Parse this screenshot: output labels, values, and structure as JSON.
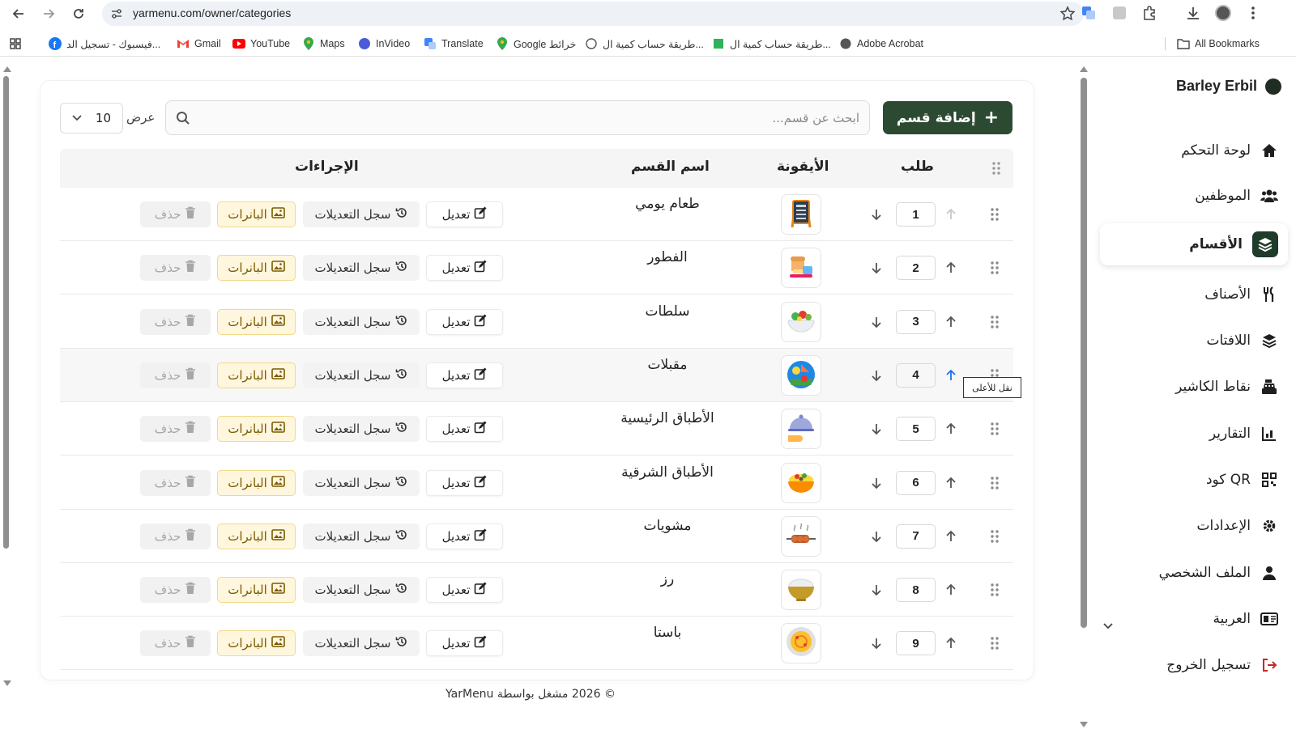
{
  "browser": {
    "url": "yarmenu.com/owner/categories",
    "bookmarks": [
      {
        "label": "فيسبوك - تسجيل الد...",
        "icon": "facebook-icon"
      },
      {
        "label": "Gmail",
        "icon": "gmail-icon"
      },
      {
        "label": "YouTube",
        "icon": "youtube-icon"
      },
      {
        "label": "Maps",
        "icon": "maps-icon"
      },
      {
        "label": "InVideo",
        "icon": "invideo-icon"
      },
      {
        "label": "Translate",
        "icon": "translate-icon"
      },
      {
        "label": "Google خرائط",
        "icon": "maps-icon"
      },
      {
        "label": "طريقة حساب كمية ال...",
        "icon": "page-icon"
      },
      {
        "label": "طريقة حساب كمية ال...",
        "icon": "page-icon"
      },
      {
        "label": "Adobe Acrobat",
        "icon": "acrobat-icon"
      }
    ],
    "all_bookmarks": "All Bookmarks"
  },
  "sidebar": {
    "brand": "Barley Erbil",
    "items": [
      {
        "label": "لوحة التحكم",
        "icon": "home-icon"
      },
      {
        "label": "الموظفين",
        "icon": "users-icon"
      },
      {
        "label": "الأقسام",
        "icon": "layers-icon",
        "active": true
      },
      {
        "label": "الأصناف",
        "icon": "utensils-icon"
      },
      {
        "label": "اللافتات",
        "icon": "layers-icon"
      },
      {
        "label": "نقاط الكاشير",
        "icon": "cash-register-icon"
      },
      {
        "label": "التقارير",
        "icon": "chart-icon"
      },
      {
        "label": "QR كود",
        "icon": "qrcode-icon"
      },
      {
        "label": "الإعدادات",
        "icon": "gear-icon"
      },
      {
        "label": "الملف الشخصي",
        "icon": "user-icon"
      },
      {
        "label": "العربية",
        "icon": "language-icon"
      },
      {
        "label": "تسجيل الخروج",
        "icon": "logout-icon"
      }
    ]
  },
  "toolbar": {
    "add_label": "إضافة قسم",
    "search_placeholder": "ابحث عن قسم...",
    "show_label": "عرض",
    "page_size": "10"
  },
  "table": {
    "headers": {
      "order": "طلب",
      "icon": "الأيقونة",
      "name": "اسم القسم",
      "actions": "الإجراءات"
    },
    "actions": {
      "edit": "تعديل",
      "log": "سجل التعديلات",
      "banners": "البانرات",
      "delete": "حذف"
    },
    "rows": [
      {
        "order": "1",
        "name": "طعام يومي",
        "icon": "menu-board-icon"
      },
      {
        "order": "2",
        "name": "الفطور",
        "icon": "breakfast-icon"
      },
      {
        "order": "3",
        "name": "سلطات",
        "icon": "salad-icon"
      },
      {
        "order": "4",
        "name": "مقبلات",
        "icon": "appetizers-icon"
      },
      {
        "order": "5",
        "name": "الأطباق الرئيسية",
        "icon": "cloche-icon"
      },
      {
        "order": "6",
        "name": "الأطباق الشرقية",
        "icon": "rice-bowl-icon"
      },
      {
        "order": "7",
        "name": "مشويات",
        "icon": "grill-icon"
      },
      {
        "order": "8",
        "name": "رز",
        "icon": "rice-icon"
      },
      {
        "order": "9",
        "name": "باستا",
        "icon": "pasta-icon"
      }
    ]
  },
  "tooltip": "نقل للأعلى",
  "footer": "© 2026 مشغل بواسطة YarMenu",
  "colors": {
    "primary": "#2c4a32",
    "banner_bg": "#fff6de",
    "active_up_arrow": "#1a73e8"
  }
}
